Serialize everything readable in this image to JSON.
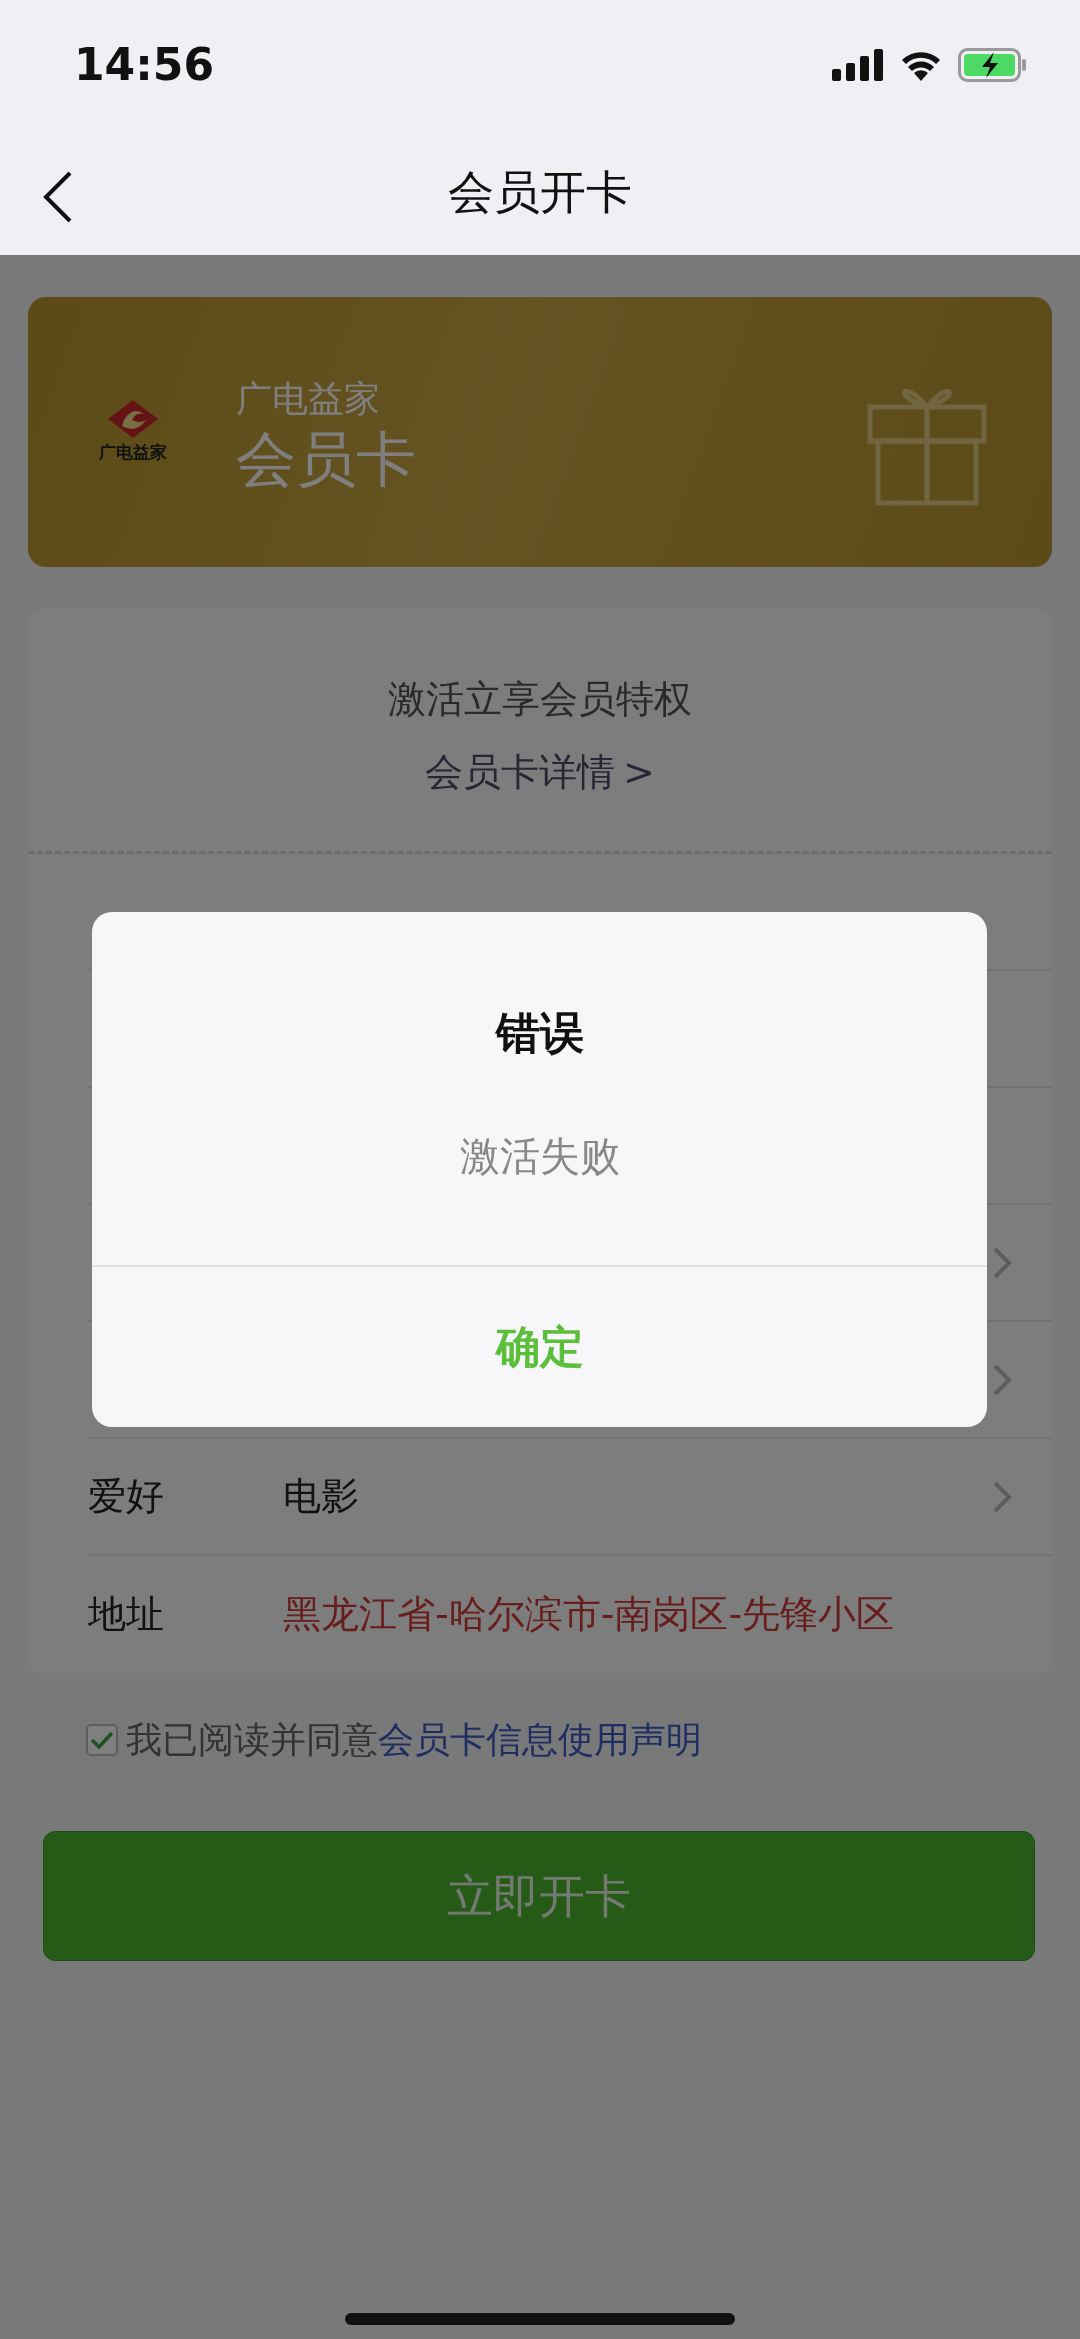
{
  "status_bar": {
    "time": "14:56"
  },
  "nav": {
    "title": "会员开卡"
  },
  "member_card": {
    "logo_text": "广电益家",
    "brand": "广电益家",
    "title": "会员卡"
  },
  "info": {
    "headline": "激活立享会员特权",
    "details_link": "会员卡详情",
    "details_arrow": ">"
  },
  "form_rows": [
    {
      "kind": "hidden",
      "chevron": false
    },
    {
      "kind": "hidden",
      "chevron": false
    },
    {
      "kind": "hidden",
      "chevron": false
    },
    {
      "kind": "hidden",
      "chevron": true
    },
    {
      "kind": "hidden",
      "chevron": true
    },
    {
      "kind": "field",
      "label": "爱好",
      "value": "电影",
      "chevron": true,
      "highlight": false
    },
    {
      "kind": "field",
      "label": "地址",
      "value": "黑龙江省-哈尔滨市-南岗区-先锋小区",
      "chevron": false,
      "highlight": true
    }
  ],
  "agreement": {
    "checked": true,
    "text": "我已阅读并同意",
    "link": "会员卡信息使用声明"
  },
  "submit_button": "立即开卡",
  "dialog": {
    "title": "错误",
    "message": "激活失败",
    "ok": "确定"
  }
}
